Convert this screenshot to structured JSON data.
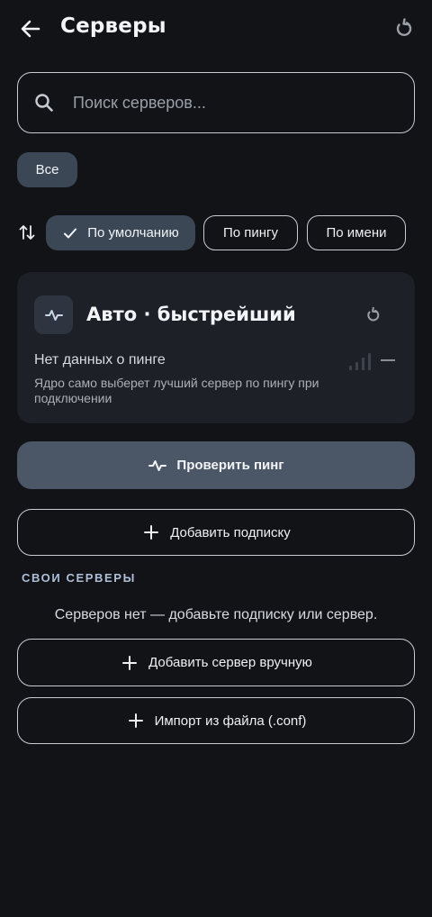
{
  "header": {
    "title": "Серверы",
    "back_icon": "arrow-left-icon",
    "refresh_icon": "refresh-icon"
  },
  "search": {
    "placeholder": "Поиск серверов...",
    "value": "",
    "icon": "search-icon"
  },
  "filters": {
    "all_label": "Все",
    "active": "all"
  },
  "sort": {
    "icon": "sort-icon",
    "options": [
      {
        "label": "По умолчанию",
        "selected": true
      },
      {
        "label": "По пингу",
        "selected": false
      },
      {
        "label": "По имени",
        "selected": false
      }
    ]
  },
  "auto_card": {
    "title": "Авто · быстрейший",
    "ping_status": "Нет данных о пинге",
    "ping_value": "—",
    "description": "Ядро само выберет лучший сервер по пингу при подключении",
    "icon": "activity-icon",
    "signal_icon": "signal-bars-icon"
  },
  "actions": {
    "check_ping_label": "Проверить пинг",
    "add_subscription_label": "Добавить подписку",
    "add_manual_label": "Добавить сервер вручную",
    "import_file_label": "Импорт из файла (.conf)"
  },
  "own_servers": {
    "section_title": "СВОИ СЕРВЕРЫ",
    "empty_text": "Серверов нет — добавьте подписку или сервер."
  },
  "colors": {
    "background": "#111317",
    "card": "#1d2026",
    "chip_selected": "#3c4756",
    "primary_button": "#4b5767",
    "outline": "#c7ccd3",
    "section_accent": "#aebfd8"
  }
}
